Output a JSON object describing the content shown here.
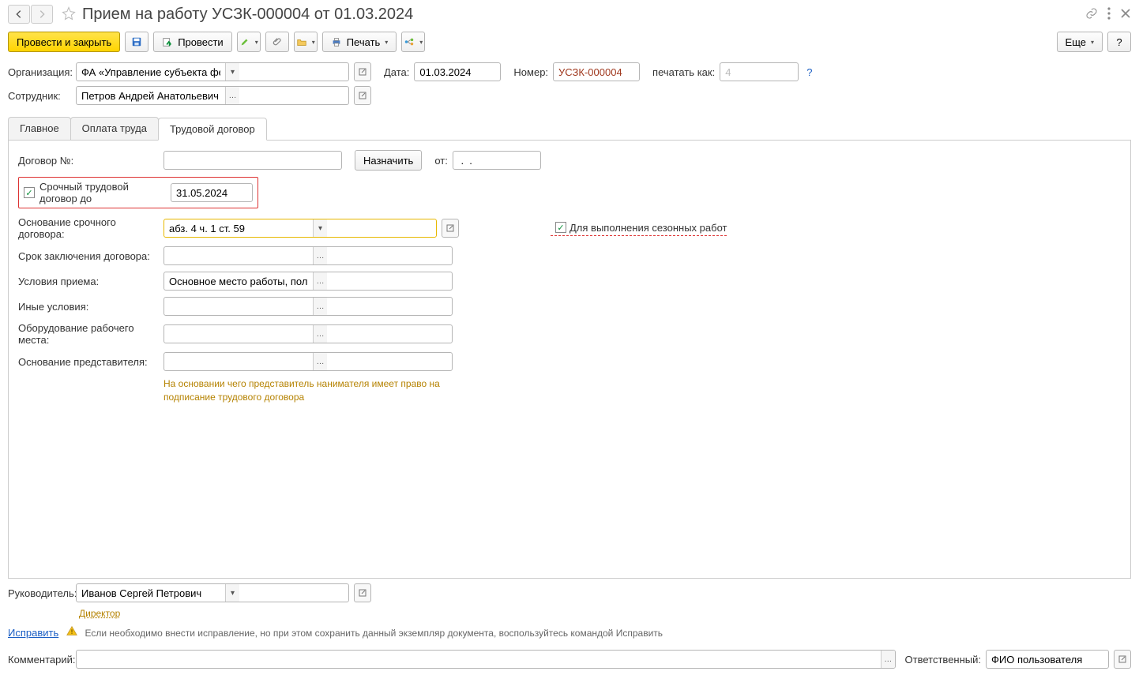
{
  "title": "Прием на работу УСЗК-000004 от 01.03.2024",
  "toolbar": {
    "post_and_close": "Провести и закрыть",
    "post": "Провести",
    "print": "Печать",
    "more": "Еще"
  },
  "header": {
    "organization_label": "Организация:",
    "organization_value": "ФА «Управление субъекта федерации»",
    "date_label": "Дата:",
    "date_value": "01.03.2024",
    "number_label": "Номер:",
    "number_value": "УСЗК-000004",
    "print_as_label": "печатать как:",
    "print_as_value": "4",
    "employee_label": "Сотрудник:",
    "employee_value": "Петров Андрей Анатольевич"
  },
  "tabs": {
    "main": "Главное",
    "payment": "Оплата труда",
    "contract": "Трудовой договор"
  },
  "contract": {
    "number_label": "Договор №:",
    "number_value": "",
    "assign_btn": "Назначить",
    "from_label": "от:",
    "from_value": " .  .",
    "fixed_term_label": "Срочный трудовой договор до",
    "fixed_term_date": "31.05.2024",
    "basis_label": "Основание срочного договора:",
    "basis_value": "абз. 4 ч. 1 ст. 59",
    "seasonal_label": "Для выполнения сезонных работ",
    "term_label": "Срок заключения договора:",
    "term_value": "",
    "conditions_label": "Условия приема:",
    "conditions_value": "Основное место работы, полная занятость",
    "other_label": "Иные условия:",
    "other_value": "",
    "equipment_label": "Оборудование рабочего места:",
    "equipment_value": "",
    "representative_label": "Основание представителя:",
    "representative_value": "",
    "representative_hint": "На основании чего представитель нанимателя имеет право на подписание трудового договора"
  },
  "footer": {
    "manager_label": "Руководитель:",
    "manager_value": "Иванов Сергей Петрович",
    "manager_position": "Директор",
    "correct_link": "Исправить",
    "warning_text": "Если необходимо внести исправление, но при этом сохранить данный экземпляр документа, воспользуйтесь командой Исправить",
    "comment_label": "Комментарий:",
    "comment_value": "",
    "responsible_label": "Ответственный:",
    "responsible_value": "ФИО пользователя"
  }
}
